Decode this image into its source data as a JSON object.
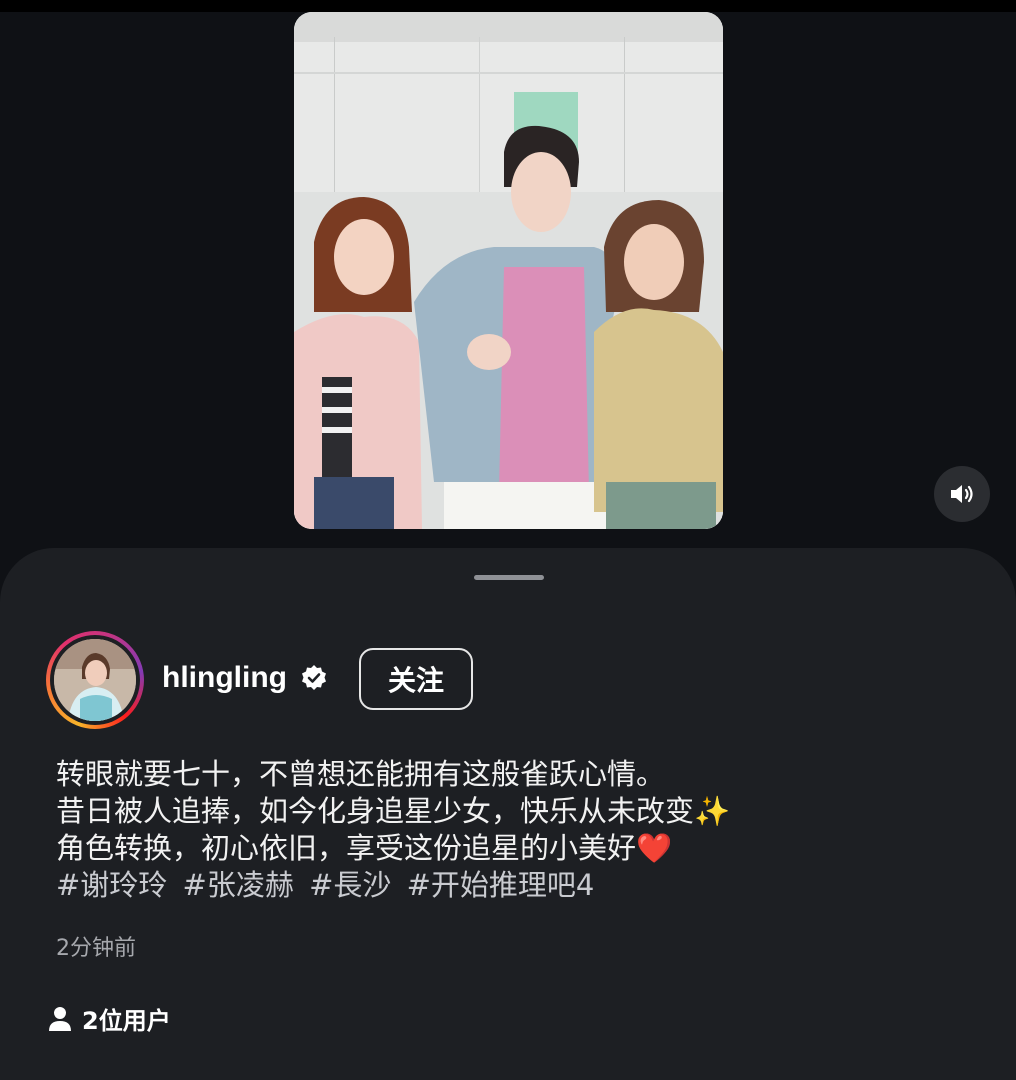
{
  "post": {
    "username": "hlingling",
    "follow_label": "关注",
    "caption_lines": [
      "转眼就要七十，不曾想还能拥有这般雀跃心情。",
      "昔日被人追捧，如今化身追星少女，快乐从未改变✨",
      "角色转换，初心依旧，享受这份追星的小美好❤️"
    ],
    "hashtags": [
      "#谢玲玲",
      "#张凌赫",
      "#長沙",
      "#开始推理吧4"
    ],
    "timestamp": "2分钟前",
    "viewers_label": "2位用户"
  },
  "icons": {
    "sound": "speaker-icon",
    "verified": "verified-badge-icon",
    "viewers": "person-icon"
  },
  "colors": {
    "background": "#0f1115",
    "sheet": "#1d1f23",
    "text": "#f2f2f2",
    "muted": "#a6a8ad"
  }
}
